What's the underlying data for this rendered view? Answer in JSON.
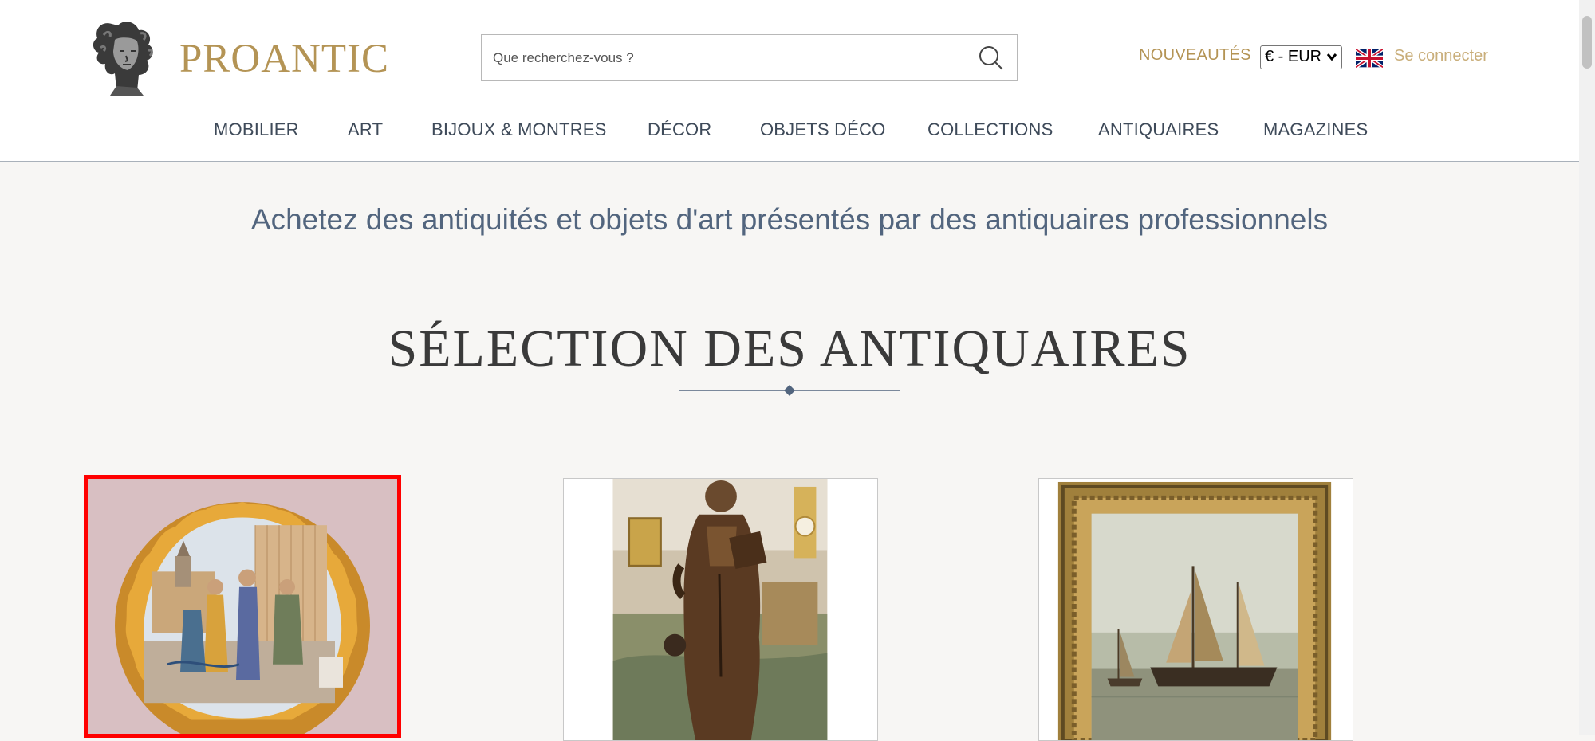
{
  "header": {
    "logo_text": "PROANTIC",
    "search_placeholder": "Que recherchez-vous ?",
    "nouveautes": "NOUVEAUTÉS",
    "currency": "€ - EUR",
    "login": "Se connecter"
  },
  "nav": {
    "items": [
      "MOBILIER",
      "ART",
      "BIJOUX & MONTRES",
      "DÉCOR",
      "OBJETS DÉCO",
      "COLLECTIONS",
      "ANTIQUAIRES",
      "MAGAZINES"
    ]
  },
  "main": {
    "tagline": "Achetez des antiquités et objets d'art présentés par des antiquaires professionnels",
    "section_title": "SÉLECTION DES ANTIQUAIRES"
  },
  "colors": {
    "brand_gold": "#b49455",
    "nav_text": "#3e4a59",
    "tagline": "#52657e",
    "selected_border": "#ff0000"
  },
  "icons": [
    "logo-bust-icon",
    "search-icon",
    "chevron-down-icon",
    "uk-flag-icon",
    "divider-diamond-icon"
  ]
}
